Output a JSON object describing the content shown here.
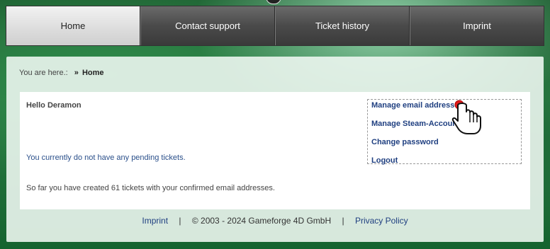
{
  "nav": {
    "items": [
      {
        "label": "Home",
        "active": true
      },
      {
        "label": "Contact support",
        "active": false
      },
      {
        "label": "Ticket history",
        "active": false
      },
      {
        "label": "Imprint",
        "active": false
      }
    ]
  },
  "breadcrumb": {
    "prefix": "You are here.:",
    "separator": "»",
    "current": "Home"
  },
  "main": {
    "greeting": "Hello Deramon",
    "pending_text": "You currently do not have any pending tickets.",
    "created_text": "So far you have created 61 tickets with your confirmed email addresses."
  },
  "account_menu": {
    "items": [
      "Manage email addresses",
      "Manage Steam-Accounts",
      "Change password",
      "Logout"
    ]
  },
  "footer": {
    "imprint": "Imprint",
    "separator": "|",
    "copyright": "© 2003 - 2024 Gameforge 4D GmbH",
    "privacy": "Privacy Policy"
  },
  "icons": {
    "cursor": "hand-pointer-cursor-icon"
  },
  "colors": {
    "link": "#1f3f80",
    "nav_active_bg": "#e6e6e6",
    "nav_bg": "#4a4a4a"
  }
}
